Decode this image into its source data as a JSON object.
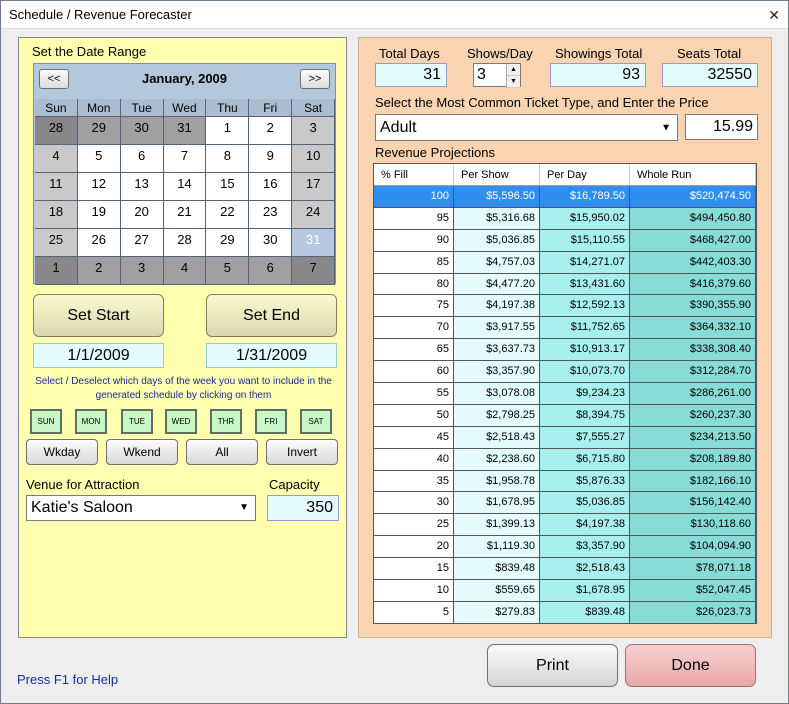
{
  "window": {
    "title": "Schedule / Revenue Forecaster",
    "close_glyph": "✕"
  },
  "left": {
    "date_range_label": "Set the Date Range",
    "calendar": {
      "prev": "<<",
      "next": ">>",
      "month": "January, 2009",
      "dow": [
        "Sun",
        "Mon",
        "Tue",
        "Wed",
        "Thu",
        "Fri",
        "Sat"
      ],
      "weeks": [
        [
          {
            "d": "28",
            "k": "other wkend"
          },
          {
            "d": "29",
            "k": "other"
          },
          {
            "d": "30",
            "k": "other"
          },
          {
            "d": "31",
            "k": "other"
          },
          {
            "d": "1",
            "k": "cur"
          },
          {
            "d": "2",
            "k": "cur"
          },
          {
            "d": "3",
            "k": "wkend"
          }
        ],
        [
          {
            "d": "4",
            "k": "wkend"
          },
          {
            "d": "5",
            "k": "cur"
          },
          {
            "d": "6",
            "k": "cur"
          },
          {
            "d": "7",
            "k": "cur"
          },
          {
            "d": "8",
            "k": "cur"
          },
          {
            "d": "9",
            "k": "cur"
          },
          {
            "d": "10",
            "k": "wkend"
          }
        ],
        [
          {
            "d": "11",
            "k": "wkend"
          },
          {
            "d": "12",
            "k": "cur"
          },
          {
            "d": "13",
            "k": "cur"
          },
          {
            "d": "14",
            "k": "cur"
          },
          {
            "d": "15",
            "k": "cur"
          },
          {
            "d": "16",
            "k": "cur"
          },
          {
            "d": "17",
            "k": "wkend"
          }
        ],
        [
          {
            "d": "18",
            "k": "wkend"
          },
          {
            "d": "19",
            "k": "cur"
          },
          {
            "d": "20",
            "k": "cur"
          },
          {
            "d": "21",
            "k": "cur"
          },
          {
            "d": "22",
            "k": "cur"
          },
          {
            "d": "23",
            "k": "cur"
          },
          {
            "d": "24",
            "k": "wkend"
          }
        ],
        [
          {
            "d": "25",
            "k": "wkend"
          },
          {
            "d": "26",
            "k": "cur"
          },
          {
            "d": "27",
            "k": "cur"
          },
          {
            "d": "28",
            "k": "cur"
          },
          {
            "d": "29",
            "k": "cur"
          },
          {
            "d": "30",
            "k": "cur"
          },
          {
            "d": "31",
            "k": "sel"
          }
        ],
        [
          {
            "d": "1",
            "k": "other wkend"
          },
          {
            "d": "2",
            "k": "other"
          },
          {
            "d": "3",
            "k": "other"
          },
          {
            "d": "4",
            "k": "other"
          },
          {
            "d": "5",
            "k": "other"
          },
          {
            "d": "6",
            "k": "other"
          },
          {
            "d": "7",
            "k": "other wkend"
          }
        ]
      ]
    },
    "set_start": "Set Start",
    "set_end": "Set End",
    "start_date": "1/1/2009",
    "end_date": "1/31/2009",
    "instructions": "Select / Deselect which days of the week you want to include in the generated schedule by clicking on them",
    "dow_buttons": [
      "SUN",
      "MON",
      "TUE",
      "WED",
      "THR",
      "FRI",
      "SAT"
    ],
    "wkday": "Wkday",
    "wkend": "Wkend",
    "all": "All",
    "invert": "Invert",
    "venue_label": "Venue for Attraction",
    "venue_value": "Katie's Saloon",
    "capacity_label": "Capacity",
    "capacity_value": "350"
  },
  "right": {
    "total_days_label": "Total Days",
    "total_days": "31",
    "shows_label": "Shows/Day",
    "shows": "3",
    "showings_label": "Showings Total",
    "showings": "93",
    "seats_label": "Seats Total",
    "seats": "32550",
    "ticket_label": "Select the Most Common Ticket Type, and Enter the Price",
    "ticket_type": "Adult",
    "price": "15.99",
    "revenue_label": "Revenue Projections",
    "columns": [
      "% Fill",
      "Per Show",
      "Per Day",
      "Whole Run"
    ],
    "rows": [
      [
        "100",
        "$5,596.50",
        "$16,789.50",
        "$520,474.50"
      ],
      [
        "95",
        "$5,316.68",
        "$15,950.02",
        "$494,450.80"
      ],
      [
        "90",
        "$5,036.85",
        "$15,110.55",
        "$468,427.00"
      ],
      [
        "85",
        "$4,757.03",
        "$14,271.07",
        "$442,403.30"
      ],
      [
        "80",
        "$4,477.20",
        "$13,431.60",
        "$416,379.60"
      ],
      [
        "75",
        "$4,197.38",
        "$12,592.13",
        "$390,355.90"
      ],
      [
        "70",
        "$3,917.55",
        "$11,752.65",
        "$364,332.10"
      ],
      [
        "65",
        "$3,637.73",
        "$10,913.17",
        "$338,308.40"
      ],
      [
        "60",
        "$3,357.90",
        "$10,073.70",
        "$312,284.70"
      ],
      [
        "55",
        "$3,078.08",
        "$9,234.23",
        "$286,261.00"
      ],
      [
        "50",
        "$2,798.25",
        "$8,394.75",
        "$260,237.30"
      ],
      [
        "45",
        "$2,518.43",
        "$7,555.27",
        "$234,213.50"
      ],
      [
        "40",
        "$2,238.60",
        "$6,715.80",
        "$208,189.80"
      ],
      [
        "35",
        "$1,958.78",
        "$5,876.33",
        "$182,166.10"
      ],
      [
        "30",
        "$1,678.95",
        "$5,036.85",
        "$156,142.40"
      ],
      [
        "25",
        "$1,399.13",
        "$4,197.38",
        "$130,118.60"
      ],
      [
        "20",
        "$1,119.30",
        "$3,357.90",
        "$104,094.90"
      ],
      [
        "15",
        "$839.48",
        "$2,518.43",
        "$78,071.18"
      ],
      [
        "10",
        "$559.65",
        "$1,678.95",
        "$52,047.45"
      ],
      [
        "5",
        "$279.83",
        "$839.48",
        "$26,023.73"
      ]
    ]
  },
  "footer": {
    "print": "Print",
    "done": "Done",
    "help": "Press F1 for Help"
  },
  "colors": {
    "left_panel": "#ffffb0",
    "right_panel": "#fad4b0",
    "selected_row": "#2f8ff0",
    "done_button": "#f0b8b8"
  }
}
